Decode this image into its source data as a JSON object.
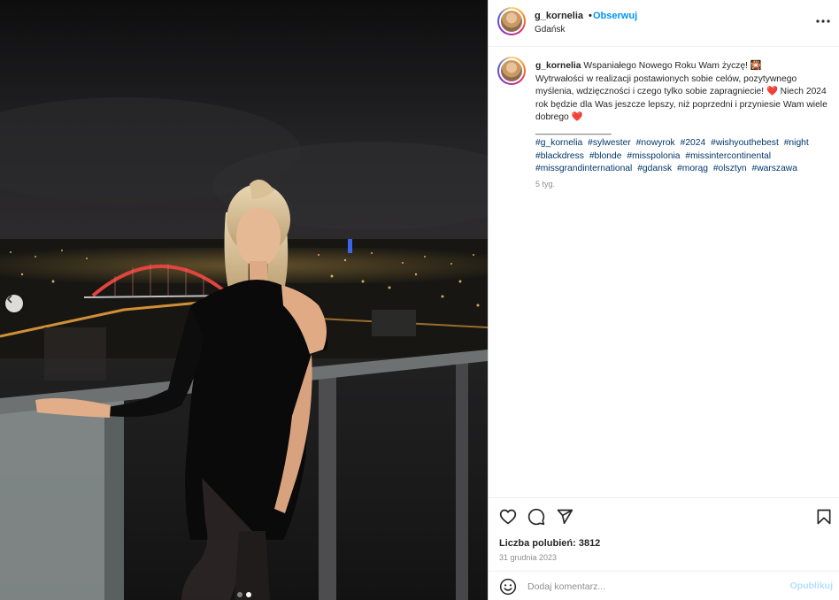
{
  "post": {
    "username": "g_kornelia",
    "separator": "•",
    "follow_label": "Obserwuj",
    "location": "Gdańsk"
  },
  "caption": {
    "username": "g_kornelia",
    "line1": "Wspaniałego Nowego Roku Wam życzę! 🎇",
    "line2": "Wytrwałości w realizacji postawionych sobie celów, pozytywnego myślenia, wdzięczności i czego tylko sobie zapragniecie! ❤️ Niech 2024 rok będzie dla Was jeszcze lepszy, niż poprzedni i przyniesie Wam wiele dobrego ❤️",
    "divider": "_______________",
    "hashtags": [
      "#g_kornelia",
      "#sylwester",
      "#nowyrok",
      "#2024",
      "#wishyouthebest",
      "#night",
      "#blackdress",
      "#blonde",
      "#misspolonia",
      "#missintercontinental",
      "#missgrandinternational",
      "#gdansk",
      "#morąg",
      "#olsztyn",
      "#warszawa"
    ],
    "time_ago": "5 tyg."
  },
  "engagement": {
    "likes": "Liczba polubień: 3812",
    "date": "31 grudnia 2023"
  },
  "comment": {
    "placeholder": "Dodaj komentarz...",
    "post_label": "Opublikuj"
  },
  "icons": {
    "like": "heart-icon",
    "comment": "comment-icon",
    "share": "share-icon",
    "save": "bookmark-icon",
    "more": "more-options-icon",
    "emoji": "emoji-icon",
    "prev": "chevron-left-icon"
  },
  "colors": {
    "link": "#0095f6",
    "hashtag": "#00376b",
    "muted": "#8e8e8e",
    "post_disabled": "#b2dffc"
  }
}
